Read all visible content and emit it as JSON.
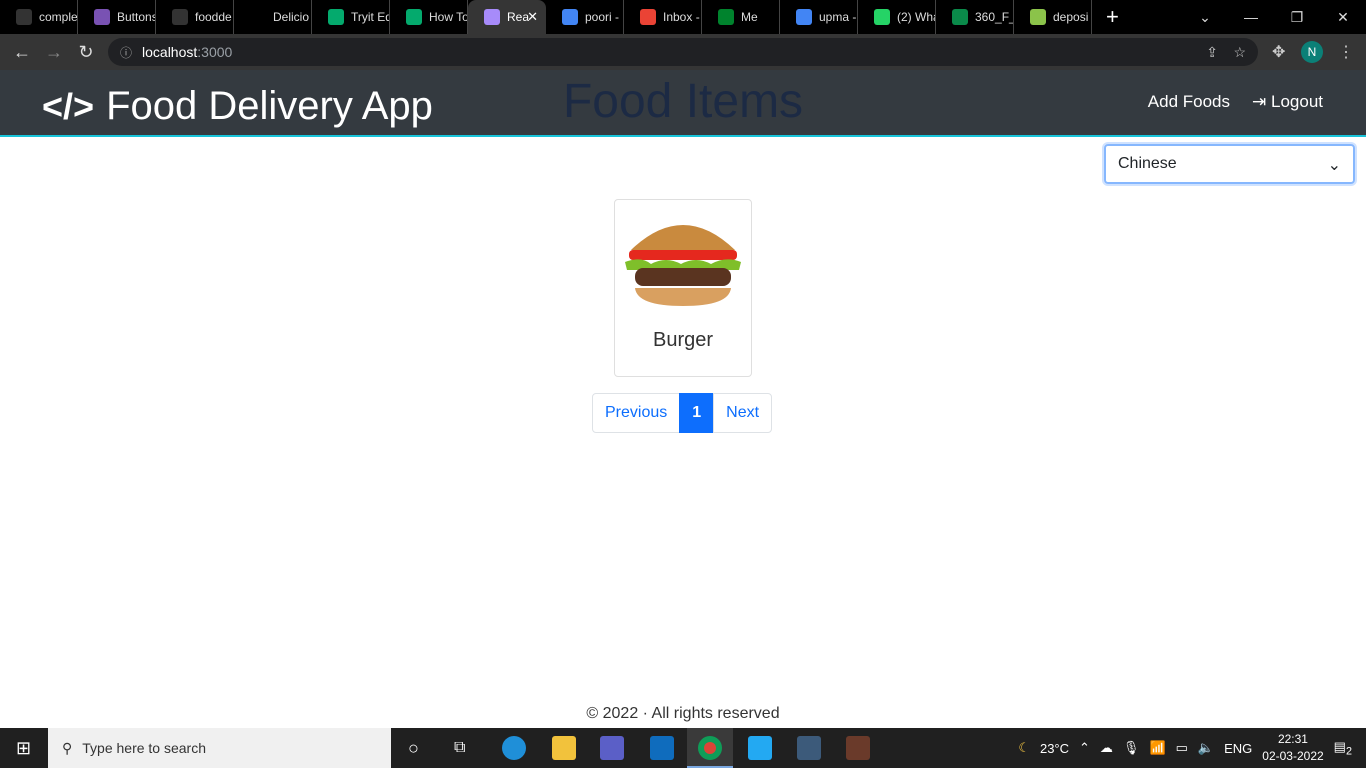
{
  "browser": {
    "tabs": [
      {
        "label": "comple",
        "color": "#333"
      },
      {
        "label": "Buttons",
        "color": "#7952b3"
      },
      {
        "label": "foodde",
        "color": "#333"
      },
      {
        "label": "Delicio",
        "color": "#000"
      },
      {
        "label": "Tryit Ed",
        "color": "#04aa6d"
      },
      {
        "label": "How To",
        "color": "#04aa6d"
      },
      {
        "label": "Rea",
        "color": "#a78bfa",
        "active": true
      },
      {
        "label": "poori -",
        "color": "#4285f4"
      },
      {
        "label": "Inbox -",
        "color": "#ea4335"
      },
      {
        "label": "Me",
        "color": "#00832d"
      },
      {
        "label": "upma -",
        "color": "#4285f4"
      },
      {
        "label": "(2) Wha",
        "color": "#25d366"
      },
      {
        "label": "360_F_",
        "color": "#0a8a4a"
      },
      {
        "label": "deposi",
        "color": "#8bc34a"
      }
    ],
    "url_host": "localhost",
    "url_port": ":3000",
    "profile": "N"
  },
  "header": {
    "brand": "Food Delivery App",
    "logo": "</>",
    "title": "Food Items",
    "add_foods": "Add Foods",
    "logout": "Logout"
  },
  "filter": {
    "selected": "Chinese"
  },
  "items": [
    {
      "name": "Burger"
    }
  ],
  "pagination": {
    "previous": "Previous",
    "current": "1",
    "next": "Next"
  },
  "footer": "© 2022 · All rights reserved",
  "taskbar": {
    "search_placeholder": "Type here to search",
    "weather": "23°C",
    "lang": "ENG",
    "time": "22:31",
    "date": "02-03-2022",
    "notifications": "2"
  }
}
